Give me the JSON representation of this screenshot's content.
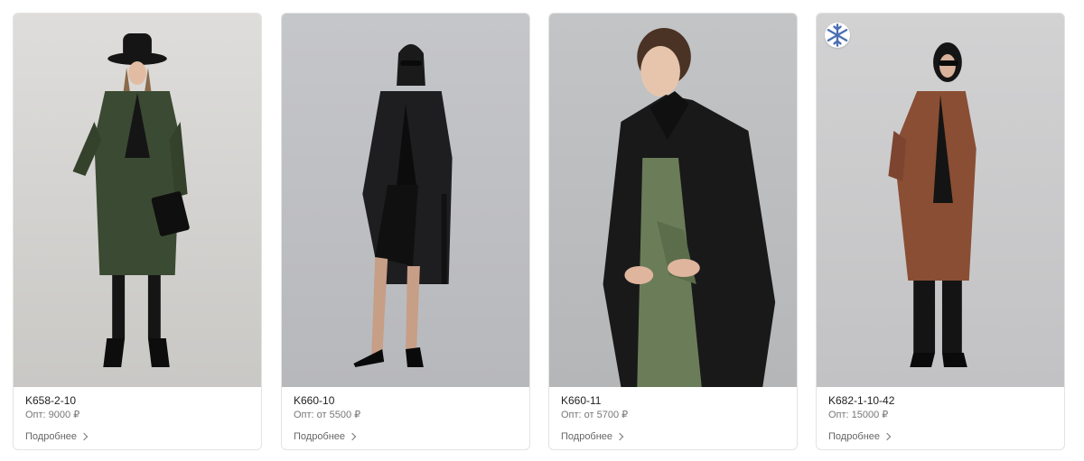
{
  "products": [
    {
      "sku": "K658-2-10",
      "price": "Опт: 9000 ₽",
      "more": "Подробнее",
      "badge": false
    },
    {
      "sku": "K660-10",
      "price": "Опт: от 5500 ₽",
      "more": "Подробнее",
      "badge": false
    },
    {
      "sku": "K660-11",
      "price": "Опт: от 5700 ₽",
      "more": "Подробнее",
      "badge": false
    },
    {
      "sku": "K682-1-10-42",
      "price": "Опт: 15000 ₽",
      "more": "Подробнее",
      "badge": true,
      "badge_icon": "snowflake-icon"
    }
  ],
  "colors": {
    "card_border": "#e3e3e3",
    "background_gray": "#cfcfcf",
    "coat_green": "#3b4a32",
    "coat_black": "#1e1e20",
    "coat_brown": "#8a4e34",
    "badge_icon": "#4a6fb3"
  }
}
